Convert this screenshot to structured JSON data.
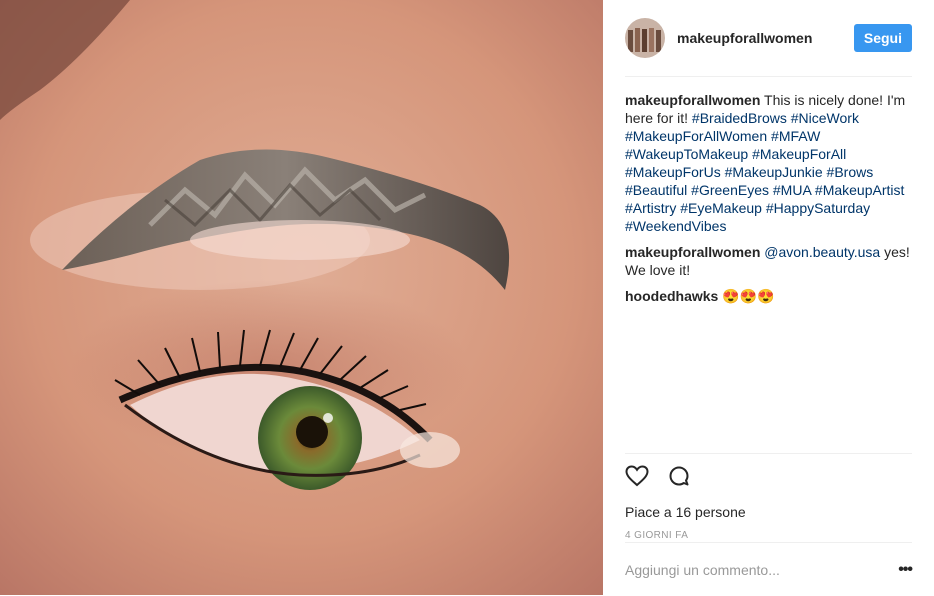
{
  "post": {
    "username": "makeupforallwomen",
    "follow_label": "Segui"
  },
  "comments": [
    {
      "user": "makeupforallwomen",
      "text": "This is nicely done! I'm here for it!",
      "tags": [
        "#BraidedBrows",
        "#NiceWork",
        "#MakeupForAllWomen",
        "#MFAW",
        "#WakeupToMakeup",
        "#MakeupForAll",
        "#MakeupForUs",
        "#MakeupJunkie",
        "#Brows",
        "#Beautiful",
        "#GreenEyes",
        "#MUA",
        "#MakeupArtist",
        "#Artistry",
        "#EyeMakeup",
        "#HappySaturday",
        "#WeekendVibes"
      ]
    },
    {
      "user": "makeupforallwomen",
      "mention": "@avon.beauty.usa",
      "text": "yes! We love it!"
    },
    {
      "user": "hoodedhawks",
      "text": "😍😍😍"
    }
  ],
  "actions": {
    "like_icon": "heart-icon",
    "comment_icon": "comment-icon",
    "likes_text": "Piace a 16 persone",
    "timestamp": "4 GIORNI FA"
  },
  "add_comment": {
    "placeholder": "Aggiungi un commento...",
    "more_label": "•••"
  },
  "colors": {
    "follow_button": "#3897f0",
    "hashtag": "#003569",
    "divider": "#efefef"
  }
}
